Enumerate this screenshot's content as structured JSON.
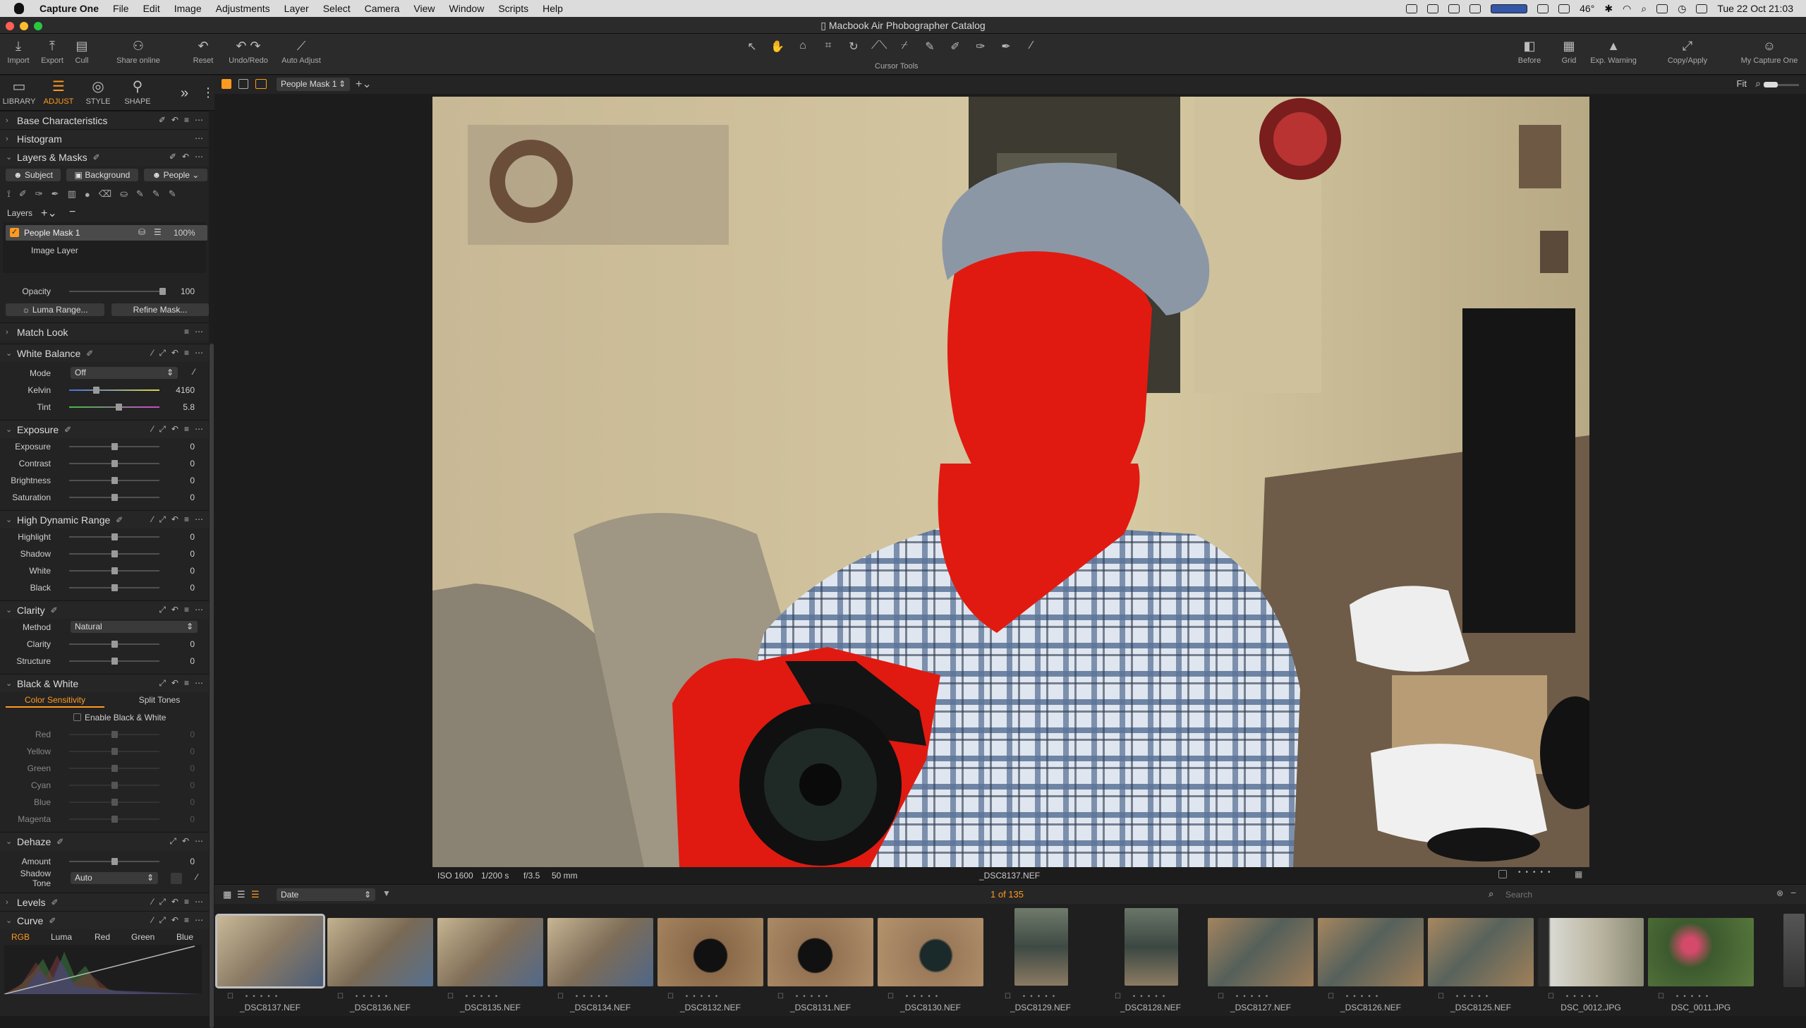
{
  "menubar": {
    "app": "Capture One",
    "items": [
      "File",
      "Edit",
      "Image",
      "Adjustments",
      "Layer",
      "Select",
      "Camera",
      "View",
      "Window",
      "Scripts",
      "Help"
    ],
    "temperature": "46°",
    "datetime": "Tue 22 Oct  21:03"
  },
  "window": {
    "title": "Macbook Air Phobographer Catalog"
  },
  "toolbar": {
    "import": "Import",
    "export": "Export",
    "cull": "Cull",
    "share_online": "Share online",
    "reset": "Reset",
    "undo_redo": "Undo/Redo",
    "auto_adjust": "Auto Adjust",
    "cursor_tools": "Cursor Tools",
    "before": "Before",
    "grid": "Grid",
    "exp_warning": "Exp. Warning",
    "copy_apply": "Copy/Apply",
    "my_capture_one": "My Capture One"
  },
  "tooltabs": [
    "LIBRARY",
    "ADJUST",
    "STYLE",
    "SHAPE"
  ],
  "viewer": {
    "layer_selector": "People Mask 1",
    "fit": "Fit",
    "caption": {
      "iso": "ISO 1600",
      "shutter": "1/200 s",
      "aperture": "f/3.5",
      "focal": "50 mm",
      "filename": "_DSC8137.NEF"
    }
  },
  "panels": {
    "base_characteristics": "Base Characteristics",
    "histogram": "Histogram",
    "layers_masks": {
      "title": "Layers & Masks",
      "subject": "Subject",
      "background": "Background",
      "people": "People",
      "layers_label": "Layers",
      "mask_layer": "People Mask 1",
      "mask_opacity": "100%",
      "image_layer": "Image Layer",
      "opacity_label": "Opacity",
      "opacity_value": "100",
      "luma_range": "Luma Range...",
      "refine_mask": "Refine Mask..."
    },
    "match_look": "Match Look",
    "white_balance": {
      "title": "White Balance",
      "mode_label": "Mode",
      "mode_value": "Off",
      "kelvin_label": "Kelvin",
      "kelvin_value": "4160",
      "tint_label": "Tint",
      "tint_value": "5.8"
    },
    "exposure": {
      "title": "Exposure",
      "rows": [
        {
          "label": "Exposure",
          "value": "0"
        },
        {
          "label": "Contrast",
          "value": "0"
        },
        {
          "label": "Brightness",
          "value": "0"
        },
        {
          "label": "Saturation",
          "value": "0"
        }
      ]
    },
    "hdr": {
      "title": "High Dynamic Range",
      "rows": [
        {
          "label": "Highlight",
          "value": "0"
        },
        {
          "label": "Shadow",
          "value": "0"
        },
        {
          "label": "White",
          "value": "0"
        },
        {
          "label": "Black",
          "value": "0"
        }
      ]
    },
    "clarity": {
      "title": "Clarity",
      "method_label": "Method",
      "method_value": "Natural",
      "rows": [
        {
          "label": "Clarity",
          "value": "0"
        },
        {
          "label": "Structure",
          "value": "0"
        }
      ]
    },
    "bw": {
      "title": "Black & White",
      "tab1": "Color Sensitivity",
      "tab2": "Split Tones",
      "enable": "Enable Black & White",
      "rows": [
        {
          "label": "Red",
          "value": "0"
        },
        {
          "label": "Yellow",
          "value": "0"
        },
        {
          "label": "Green",
          "value": "0"
        },
        {
          "label": "Cyan",
          "value": "0"
        },
        {
          "label": "Blue",
          "value": "0"
        },
        {
          "label": "Magenta",
          "value": "0"
        }
      ]
    },
    "dehaze": {
      "title": "Dehaze",
      "amount_label": "Amount",
      "amount_value": "0",
      "shadow_label": "Shadow Tone",
      "shadow_value": "Auto"
    },
    "levels": "Levels",
    "curve": {
      "title": "Curve",
      "tabs": [
        "RGB",
        "Luma",
        "Red",
        "Green",
        "Blue"
      ]
    }
  },
  "browser": {
    "sort": "Date",
    "count": "1 of 135",
    "search_placeholder": "Search",
    "thumbnails": [
      "_DSC8137.NEF",
      "_DSC8136.NEF",
      "_DSC8135.NEF",
      "_DSC8134.NEF",
      "_DSC8132.NEF",
      "_DSC8131.NEF",
      "_DSC8130.NEF",
      "_DSC8129.NEF",
      "_DSC8128.NEF",
      "_DSC8127.NEF",
      "_DSC8126.NEF",
      "_DSC8125.NEF",
      "DSC_0012.JPG",
      "DSC_0011.JPG"
    ]
  },
  "colors": {
    "accent": "#ff9a1f",
    "mask_red": "#e01a10"
  }
}
